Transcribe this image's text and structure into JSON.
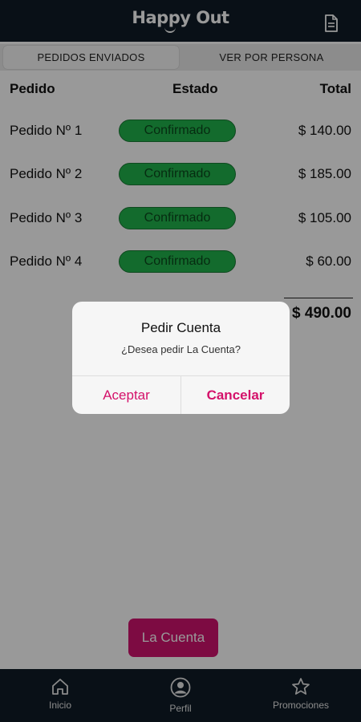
{
  "header": {
    "brand": "Happy Out",
    "doc_icon": "document-icon"
  },
  "tabs": [
    {
      "label": "PEDIDOS ENVIADOS",
      "active": true
    },
    {
      "label": "VER POR PERSONA",
      "active": false
    }
  ],
  "table": {
    "columns": [
      "Pedido",
      "Estado",
      "Total"
    ],
    "rows": [
      {
        "pedido": "Pedido Nº 1",
        "estado": "Confirmado",
        "total": "$ 140.00"
      },
      {
        "pedido": "Pedido Nº 2",
        "estado": "Confirmado",
        "total": "$ 185.00"
      },
      {
        "pedido": "Pedido Nº 3",
        "estado": "Confirmado",
        "total": "$ 105.00"
      },
      {
        "pedido": "Pedido Nº 4",
        "estado": "Confirmado",
        "total": "$ 60.00"
      }
    ],
    "grand_total": "$ 490.00"
  },
  "cuenta_button": "La Cuenta",
  "dialog": {
    "title": "Pedir Cuenta",
    "message": "¿Desea pedir La Cuenta?",
    "accept": "Aceptar",
    "cancel": "Cancelar"
  },
  "navbar": {
    "items": [
      {
        "label": "Inicio",
        "icon": "home-icon"
      },
      {
        "label": "Perfil",
        "icon": "profile-icon"
      },
      {
        "label": "Promociones",
        "icon": "star-icon"
      }
    ]
  },
  "colors": {
    "header_bg": "#0f1b27",
    "accent": "#d0136e",
    "status_green": "#21b24b"
  }
}
